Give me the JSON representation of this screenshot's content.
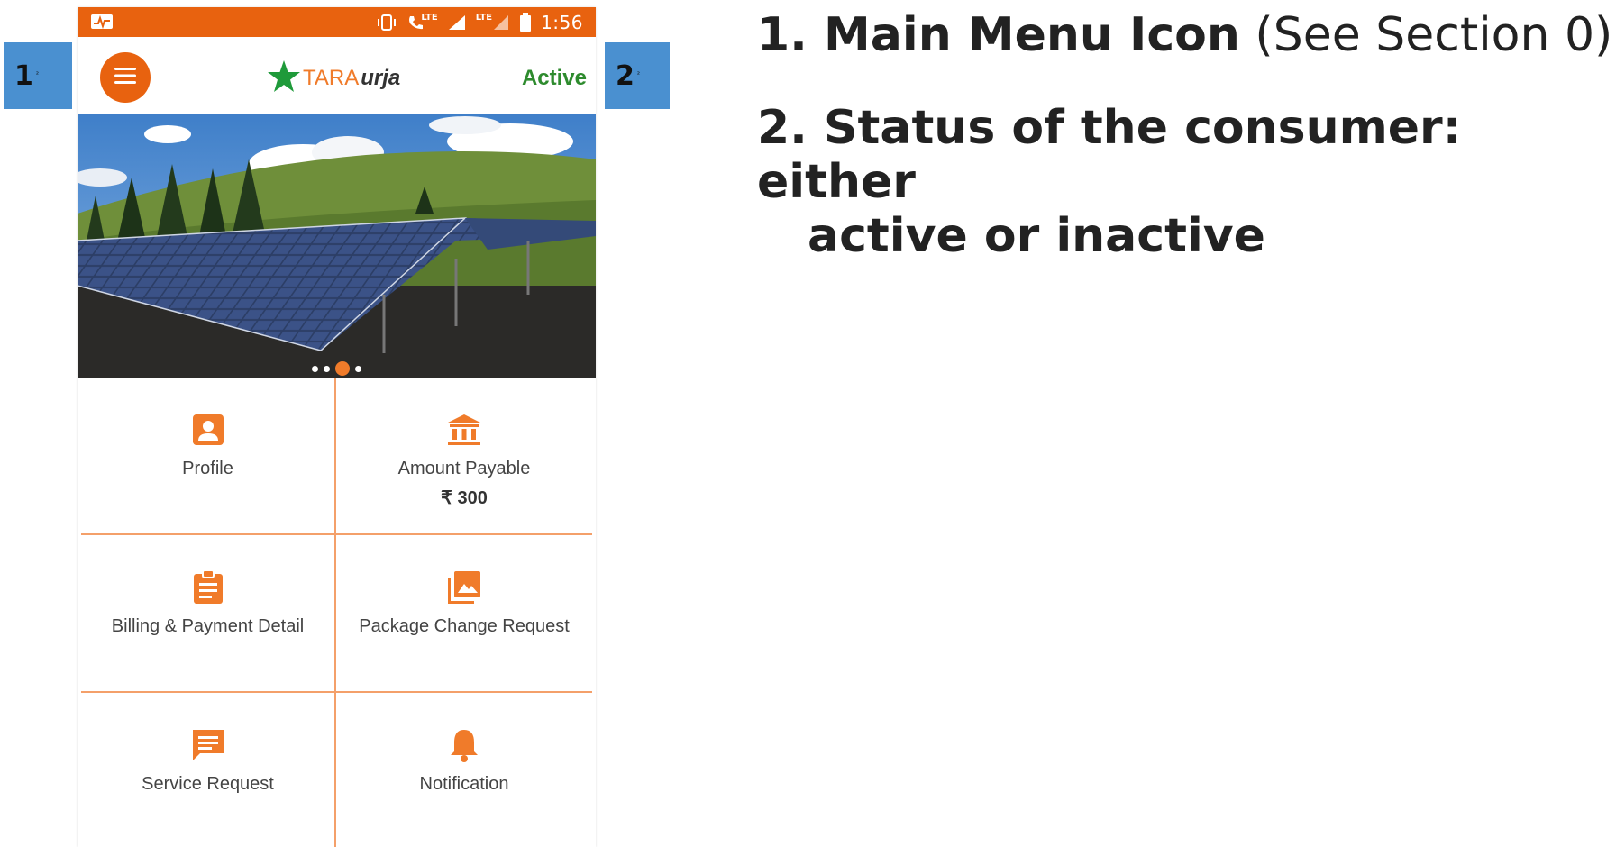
{
  "statusbar": {
    "time": "1:56",
    "network_labels": [
      "LTE",
      "LTE"
    ]
  },
  "appbar": {
    "logo_tara": "TARA",
    "logo_urja": "urja",
    "status": "Active"
  },
  "banner": {
    "slides": 4,
    "active_slide": 3
  },
  "tiles": [
    {
      "label": "Profile",
      "icon": "profile-icon"
    },
    {
      "label": "Amount Payable",
      "amount": "₹ 300",
      "icon": "bank-icon"
    },
    {
      "label": "Billing & Payment Detail",
      "icon": "clipboard-icon"
    },
    {
      "label": "Package Change Request",
      "icon": "gallery-icon"
    },
    {
      "label": "Service Request",
      "icon": "message-icon"
    },
    {
      "label": "Notification",
      "icon": "bell-icon"
    }
  ],
  "markers": [
    {
      "num": "1",
      "sup": "²"
    },
    {
      "num": "2",
      "sup": "²"
    }
  ],
  "notes": {
    "n1_bold": "1. Main Menu Icon",
    "n1_rest": " (See Section 0)",
    "n2_line1": "2. Status of the consumer: either",
    "n2_line2": "active or inactive"
  },
  "colors": {
    "accent": "#e8620f",
    "tile_border": "#f4a06a",
    "active_green": "#2e8b2e",
    "marker_blue": "#4a90d0"
  }
}
